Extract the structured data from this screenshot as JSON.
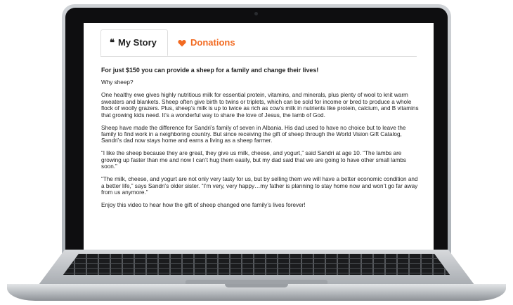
{
  "tabs": {
    "story_label": "My Story",
    "donations_label": "Donations",
    "story_icon_glyph": "❝",
    "donations_color": "#f26a21"
  },
  "content": {
    "headline": "For just $150 you can provide a sheep for a family and change their lives!",
    "question": "Why sheep?",
    "p1": "One healthy ewe gives highly nutritious milk for essential protein, vitamins, and minerals, plus plenty of wool to knit warm sweaters and blankets. Sheep often give birth to twins or triplets, which can be sold for income or bred to produce a whole flock of woolly grazers. Plus, sheep’s milk is up to twice as rich as cow’s milk in nutrients like protein, calcium, and B vitamins that growing kids need. It’s a wonderful way to share the love of Jesus, the lamb of God.",
    "p2": "Sheep have made the difference for Sandri’s family of seven in Albania. His dad used to have no choice but to leave the family to find work in a neighboring country. But since receiving the gift of sheep through the World Vision Gift Catalog, Sandri’s dad now stays home and earns a living as a sheep farmer.",
    "p3": "“I like the sheep because they are great, they give us milk, cheese, and yogurt,” said Sandri at age 10. “The lambs are growing up faster than me and now I can’t hug them easily, but my dad said that we are going to have other small lambs soon.”",
    "p4": "“The milk, cheese, and yogurt are not only very tasty for us, but by selling them we will have a better economic condition and a better life,” says Sandri’s older sister. “I’m very, very happy…my father is planning to stay home now and won’t go far away from us anymore.”",
    "p5": "Enjoy this video to hear how the gift of sheep changed one family’s lives forever!"
  }
}
